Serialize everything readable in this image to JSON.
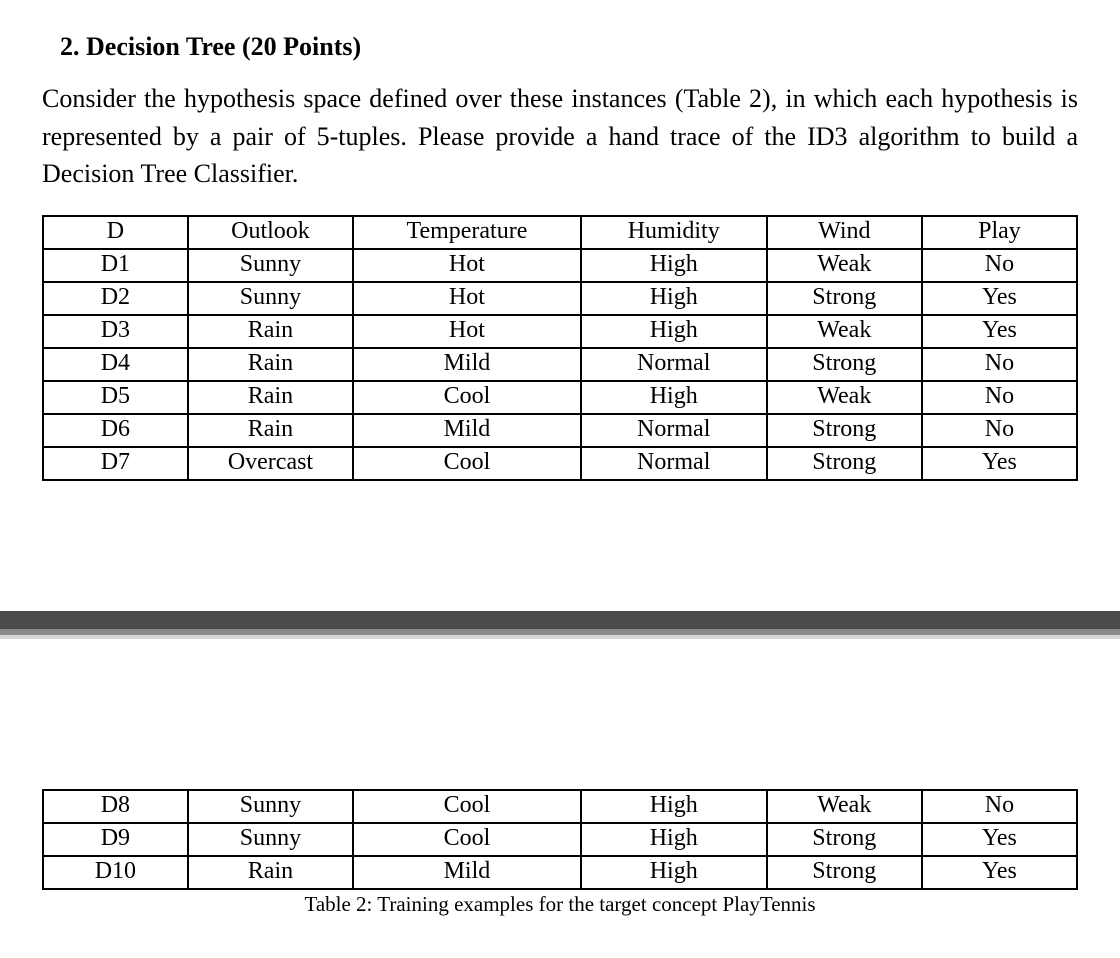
{
  "heading": "2.  Decision Tree (20 Points)",
  "paragraph": "Consider the hypothesis space defined over these instances (Table 2), in which each hypothesis is represented by a pair of 5-tuples. Please provide a hand trace of the ID3 algorithm to build a Decision Tree Classifier.",
  "columns": [
    "D",
    "Outlook",
    "Temperature",
    "Humidity",
    "Wind",
    "Play"
  ],
  "rows_top": [
    [
      "D1",
      "Sunny",
      "Hot",
      "High",
      "Weak",
      "No"
    ],
    [
      "D2",
      "Sunny",
      "Hot",
      "High",
      "Strong",
      "Yes"
    ],
    [
      "D3",
      "Rain",
      "Hot",
      "High",
      "Weak",
      "Yes"
    ],
    [
      "D4",
      "Rain",
      "Mild",
      "Normal",
      "Strong",
      "No"
    ],
    [
      "D5",
      "Rain",
      "Cool",
      "High",
      "Weak",
      "No"
    ],
    [
      "D6",
      "Rain",
      "Mild",
      "Normal",
      "Strong",
      "No"
    ],
    [
      "D7",
      "Overcast",
      "Cool",
      "Normal",
      "Strong",
      "Yes"
    ]
  ],
  "rows_bottom": [
    [
      "D8",
      "Sunny",
      "Cool",
      "High",
      "Weak",
      "No"
    ],
    [
      "D9",
      "Sunny",
      "Cool",
      "High",
      "Strong",
      "Yes"
    ],
    [
      "D10",
      "Rain",
      "Mild",
      "High",
      "Strong",
      "Yes"
    ]
  ],
  "caption": "Table 2: Training examples for the target concept PlayTennis"
}
